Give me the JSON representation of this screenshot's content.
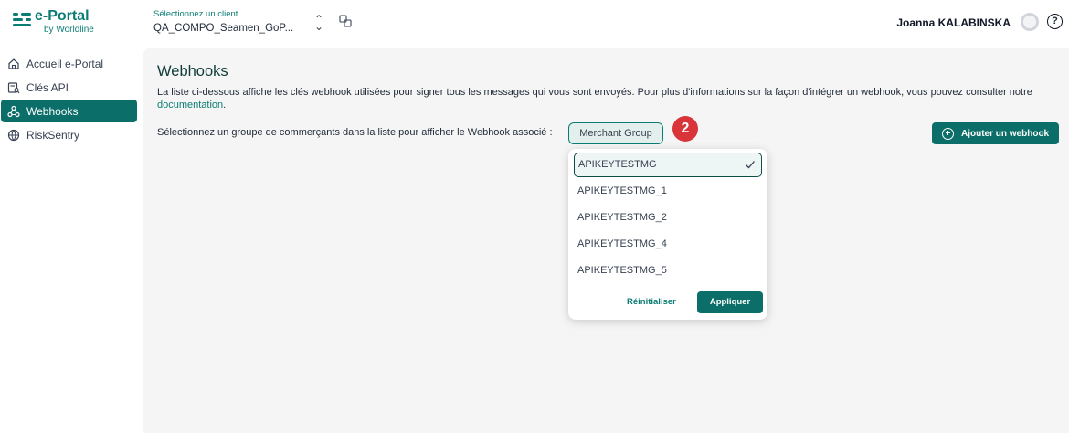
{
  "brand": {
    "title": "e-Portal",
    "subtitle": "by Worldline"
  },
  "client": {
    "label": "Sélectionnez un client",
    "value": "QA_COMPO_Seamen_GoP..."
  },
  "user": {
    "name": "Joanna KALABINSKA",
    "help": "?"
  },
  "sidebar": {
    "items": [
      {
        "label": "Accueil e-Portal",
        "icon": "home-icon"
      },
      {
        "label": "Clés API",
        "icon": "api-key-icon"
      },
      {
        "label": "Webhooks",
        "icon": "webhook-icon",
        "active": true
      },
      {
        "label": "RiskSentry",
        "icon": "globe-icon"
      }
    ]
  },
  "page": {
    "title": "Webhooks",
    "description": "La liste ci-dessous affiche les clés webhook utilisées pour signer tous les messages qui vous sont envoyés. Pour plus d'informations sur la façon d'intégrer un webhook, vous pouvez consulter notre",
    "doc_link": "documentation",
    "doc_suffix": ".",
    "select_label": "Sélectionnez un groupe de commerçants dans la liste pour afficher le Webhook associé :",
    "merchant_group_button": "Merchant Group",
    "step_badge": "2",
    "add_webhook": "Ajouter un webhook"
  },
  "dropdown": {
    "options": [
      {
        "label": "APIKEYTESTMG",
        "selected": true
      },
      {
        "label": "APIKEYTESTMG_1"
      },
      {
        "label": "APIKEYTESTMG_2"
      },
      {
        "label": "APIKEYTESTMG_4"
      },
      {
        "label": "APIKEYTESTMG_5"
      }
    ],
    "reset": "Réinitialiser",
    "apply": "Appliquer"
  },
  "colors": {
    "accent": "#0b6e68",
    "badge": "#d9343a",
    "background": "#f5f5f5"
  }
}
